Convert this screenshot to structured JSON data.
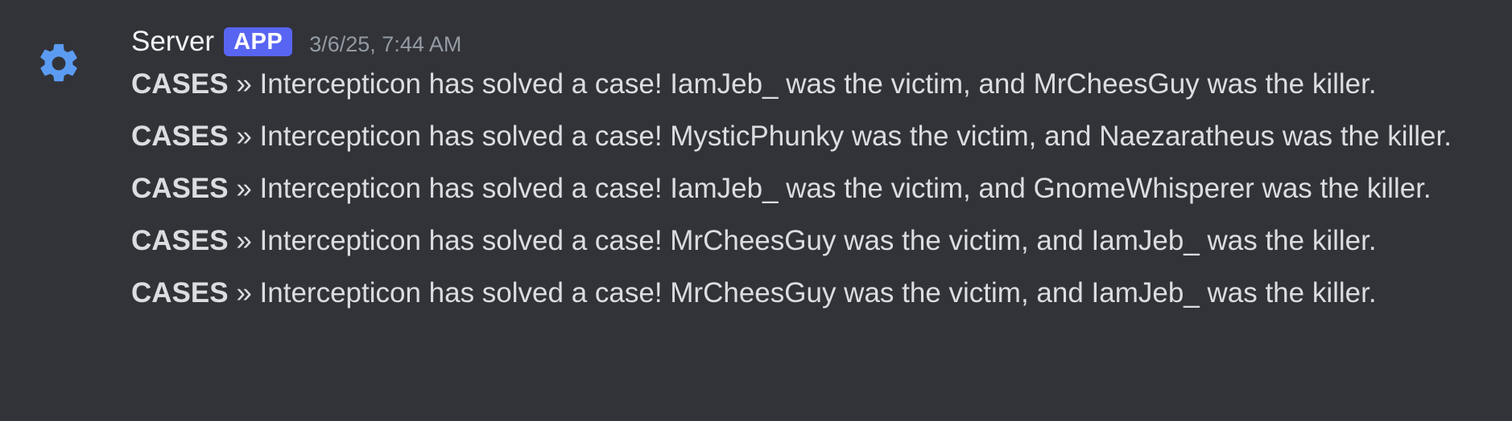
{
  "message": {
    "author": "Server",
    "badge": "APP",
    "timestamp": "3/6/25, 7:44 AM",
    "avatar_icon": "gear-icon",
    "colors": {
      "background": "#323339",
      "badge": "#5865f2",
      "avatar_gear": "#5b9cf2",
      "text": "#dbdee1",
      "timestamp": "#949ba4"
    },
    "lines": [
      {
        "tag": "CASES",
        "separator": "»",
        "text": "Intercepticon has solved a case! IamJeb_ was the victim, and MrCheesGuy was the killer."
      },
      {
        "tag": "CASES",
        "separator": "»",
        "text": "Intercepticon has solved a case! MysticPhunky was the victim, and Naezaratheus was the killer."
      },
      {
        "tag": "CASES",
        "separator": "»",
        "text": "Intercepticon has solved a case! IamJeb_ was the victim, and GnomeWhisperer was the killer."
      },
      {
        "tag": "CASES",
        "separator": "»",
        "text": "Intercepticon has solved a case! MrCheesGuy was the victim, and IamJeb_ was the killer."
      },
      {
        "tag": "CASES",
        "separator": "»",
        "text": "Intercepticon has solved a case! MrCheesGuy was the victim, and IamJeb_ was the killer."
      }
    ]
  }
}
